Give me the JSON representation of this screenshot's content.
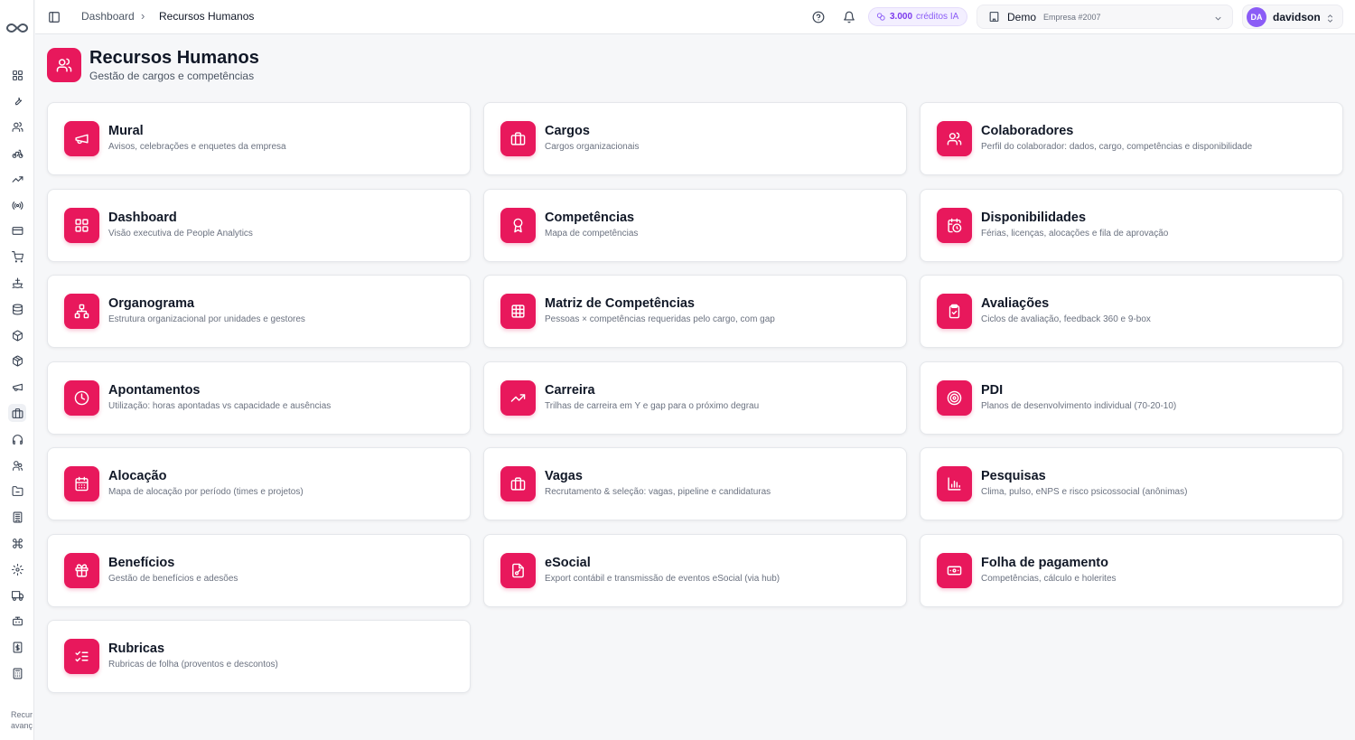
{
  "sidebar": {
    "footer_text_line1": "Recur",
    "footer_text_line2": "avanç",
    "icons": [
      "layout-grid-icon",
      "wrench-icon",
      "users-icon",
      "bike-icon",
      "trending-up-icon",
      "radio-icon",
      "credit-card-icon",
      "cart-icon",
      "ship-icon",
      "database-icon",
      "package-icon",
      "box-icon",
      "megaphone-icon",
      "briefcase-icon",
      "headphones-icon",
      "user-group-icon",
      "folder-icon",
      "building-icon",
      "command-icon",
      "settings-icon",
      "truck-icon",
      "bot-icon",
      "receipt-icon",
      "calculator-icon"
    ]
  },
  "topbar": {
    "breadcrumb_home": "Dashboard",
    "breadcrumb_sep": "›",
    "breadcrumb_current": "Recursos Humanos",
    "credits_value": "3.000",
    "credits_label": "créditos IA",
    "company_name": "Demo",
    "company_sub": "Empresa #2007",
    "user_initials": "DA",
    "user_name": "davidson"
  },
  "header": {
    "title": "Recursos Humanos",
    "subtitle": "Gestão de cargos e competências"
  },
  "cards": [
    {
      "title": "Mural",
      "desc": "Avisos, celebrações e enquetes da empresa",
      "icon": "megaphone-icon"
    },
    {
      "title": "Cargos",
      "desc": "Cargos organizacionais",
      "icon": "briefcase-icon"
    },
    {
      "title": "Colaboradores",
      "desc": "Perfil do colaborador: dados, cargo, competências e disponibilidade",
      "icon": "users-icon"
    },
    {
      "title": "Dashboard",
      "desc": "Visão executiva de People Analytics",
      "icon": "layout-grid-icon"
    },
    {
      "title": "Competências",
      "desc": "Mapa de competências",
      "icon": "award-icon"
    },
    {
      "title": "Disponibilidades",
      "desc": "Férias, licenças, alocações e fila de aprovação",
      "icon": "calendar-clock-icon"
    },
    {
      "title": "Organograma",
      "desc": "Estrutura organizacional por unidades e gestores",
      "icon": "org-chart-icon"
    },
    {
      "title": "Matriz de Competências",
      "desc": "Pessoas × competências requeridas pelo cargo, com gap",
      "icon": "grid-icon"
    },
    {
      "title": "Avaliações",
      "desc": "Ciclos de avaliação, feedback 360 e 9-box",
      "icon": "clipboard-check-icon"
    },
    {
      "title": "Apontamentos",
      "desc": "Utilização: horas apontadas vs capacidade e ausências",
      "icon": "clock-icon"
    },
    {
      "title": "Carreira",
      "desc": "Trilhas de carreira em Y e gap para o próximo degrau",
      "icon": "trending-up-icon"
    },
    {
      "title": "PDI",
      "desc": "Planos de desenvolvimento individual (70-20-10)",
      "icon": "target-icon"
    },
    {
      "title": "Alocação",
      "desc": "Mapa de alocação por período (times e projetos)",
      "icon": "calendar-icon"
    },
    {
      "title": "Vagas",
      "desc": "Recrutamento & seleção: vagas, pipeline e candidaturas",
      "icon": "briefcase-icon"
    },
    {
      "title": "Pesquisas",
      "desc": "Clima, pulso, eNPS e risco psicossocial (anônimas)",
      "icon": "bar-chart-icon"
    },
    {
      "title": "Benefícios",
      "desc": "Gestão de benefícios e adesões",
      "icon": "gift-icon"
    },
    {
      "title": "eSocial",
      "desc": "Export contábil e transmissão de eventos eSocial (via hub)",
      "icon": "file-export-icon"
    },
    {
      "title": "Folha de pagamento",
      "desc": "Competências, cálculo e holerites",
      "icon": "banknote-icon"
    },
    {
      "title": "Rubricas",
      "desc": "Rubricas de folha (proventos e descontos)",
      "icon": "list-checks-icon"
    }
  ],
  "colors": {
    "accent": "#e8185c",
    "credits_accent": "#7c3aed",
    "avatar": "#8b5cf6"
  }
}
